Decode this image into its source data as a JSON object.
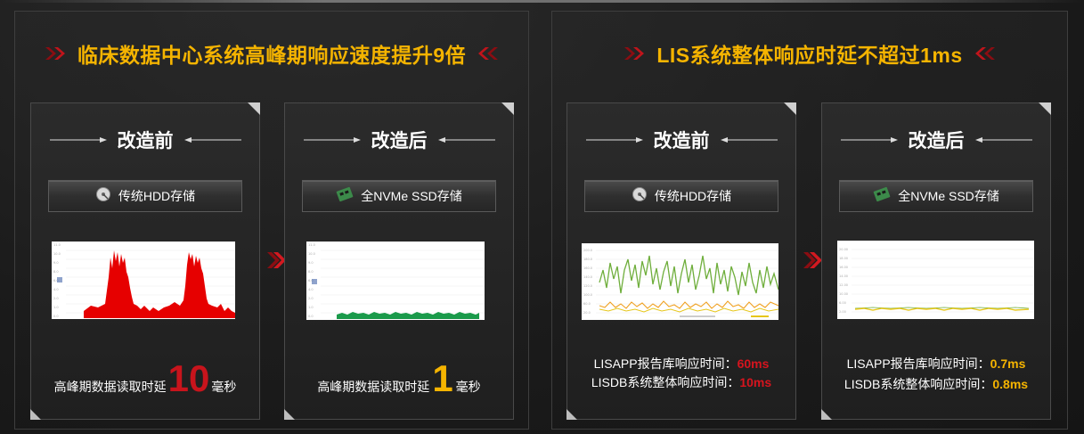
{
  "sections": [
    {
      "title": "临床数据中心系统高峰期响应速度提升9倍",
      "before": {
        "heading": "改造前",
        "storage_label": "传统HDD存储",
        "storage_icon": "hdd-icon",
        "caption_prefix": "高峰期数据读取时延",
        "caption_value": "10",
        "caption_suffix": "毫秒"
      },
      "after": {
        "heading": "改造后",
        "storage_label": "全NVMe SSD存储",
        "storage_icon": "ssd-icon",
        "caption_prefix": "高峰期数据读取时延",
        "caption_value": "1",
        "caption_suffix": "毫秒"
      }
    },
    {
      "title": "LIS系统整体响应时延不超过1ms",
      "before": {
        "heading": "改造前",
        "storage_label": "传统HDD存储",
        "storage_icon": "hdd-icon",
        "metric1_label": "LISAPP报告库响应时间：",
        "metric1_value": "60ms",
        "metric2_label": "LISDB系统整体响应时间：",
        "metric2_value": "10ms"
      },
      "after": {
        "heading": "改造后",
        "storage_label": "全NVMe SSD存储",
        "storage_icon": "ssd-icon",
        "metric1_label": "LISAPP报告库响应时间：",
        "metric1_value": "0.7ms",
        "metric2_label": "LISDB系统整体响应时间：",
        "metric2_value": "0.8ms"
      }
    }
  ],
  "colors": {
    "title_gold": "#f5b400",
    "value_red": "#c8141c",
    "hdd_chart_red": "#e60000",
    "ssd_chart_green": "#1a9a4a",
    "lis_green": "#6fae3c",
    "lis_orange": "#f0a020",
    "lis_yellow": "#e6c619"
  }
}
